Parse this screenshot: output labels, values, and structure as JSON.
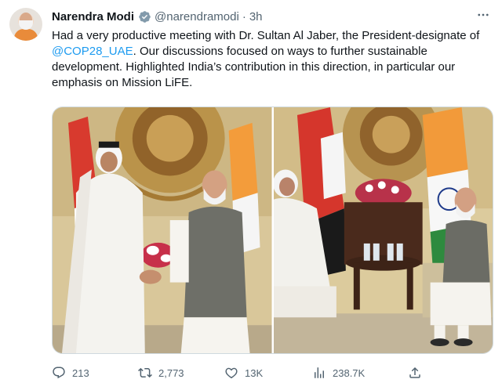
{
  "author": {
    "name": "Narendra Modi",
    "handle": "@narendramodi",
    "separator": "·",
    "time": "3h"
  },
  "tweet": {
    "text_part1": "Had a very productive meeting with Dr. Sultan Al Jaber, the President-designate of ",
    "mention": "@COP28_UAE",
    "text_part2": ". Our discussions focused on ways to further sustainable development. Highlighted India’s contribution in this direction, in particular our emphasis on Mission LiFE."
  },
  "stats": {
    "replies": "213",
    "retweets": "2,773",
    "likes": "13K",
    "views": "238.7K"
  },
  "icons": {
    "verified": "verified-badge-icon",
    "more": "more-icon",
    "reply": "reply-icon",
    "retweet": "retweet-icon",
    "like": "heart-icon",
    "views": "views-icon",
    "share": "share-icon"
  },
  "colors": {
    "accent": "#1d9bf0",
    "muted": "#536471",
    "text": "#0f1419"
  }
}
